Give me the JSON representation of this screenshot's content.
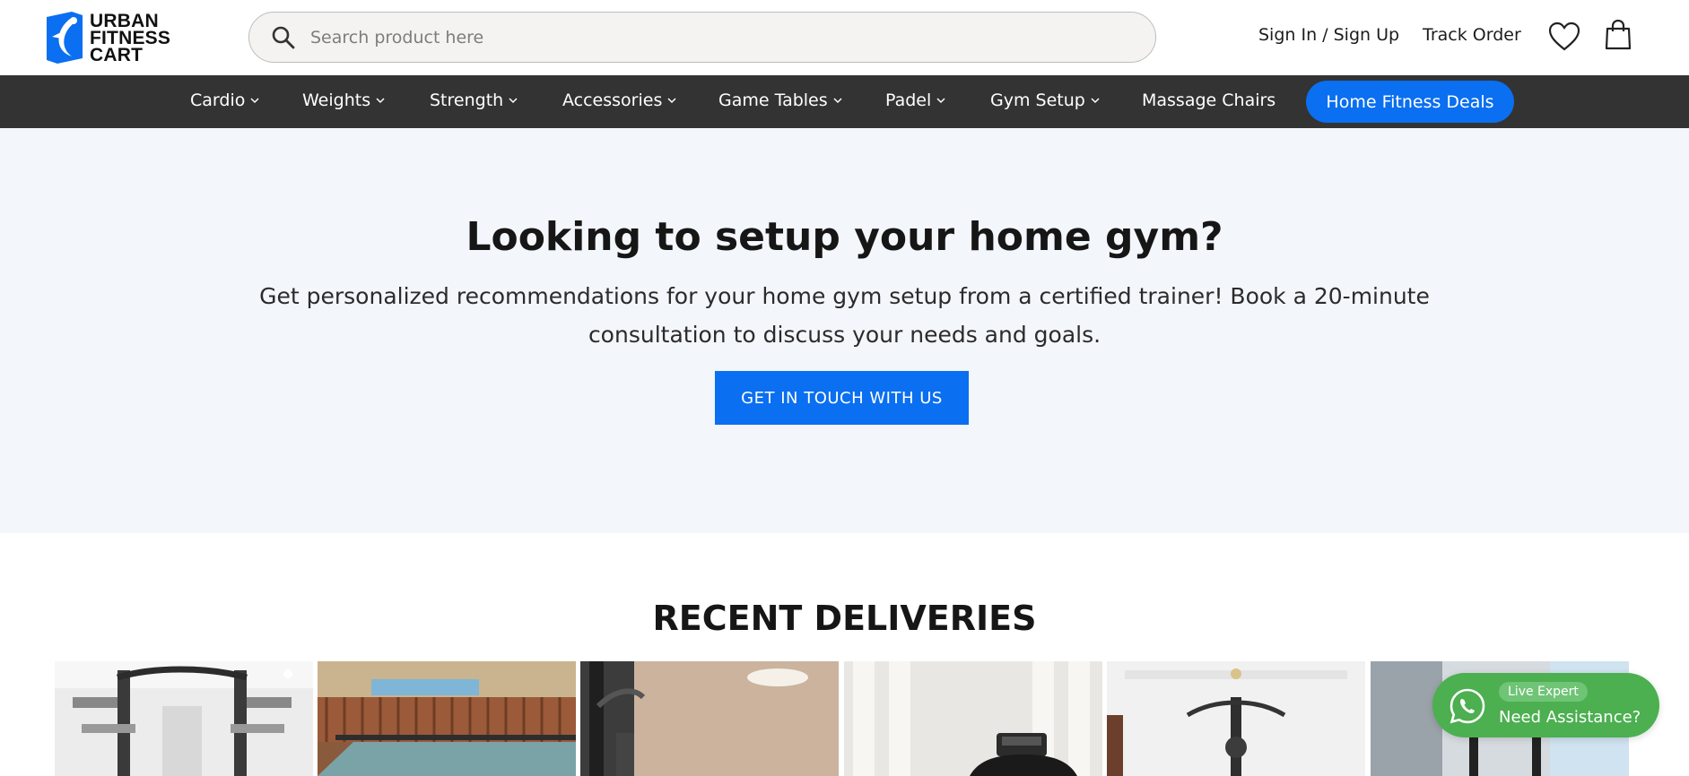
{
  "brand": {
    "name_lines": [
      "URBAN",
      "FITNESS",
      "CART"
    ],
    "accent": "#0a6ff0"
  },
  "search": {
    "placeholder": "Search product here"
  },
  "header": {
    "signin_label": "Sign In / Sign Up",
    "track_label": "Track Order"
  },
  "nav": {
    "items": [
      {
        "label": "Cardio"
      },
      {
        "label": "Weights"
      },
      {
        "label": "Strength"
      },
      {
        "label": "Accessories"
      },
      {
        "label": "Game Tables"
      },
      {
        "label": "Padel"
      },
      {
        "label": "Gym Setup"
      },
      {
        "label": "Massage Chairs"
      }
    ],
    "deals_label": "Home Fitness Deals"
  },
  "hero": {
    "title": "Looking to setup your home gym?",
    "description": "Get personalized recommendations for your home gym setup from a certified trainer! Book a 20-minute consultation to discuss your needs and goals.",
    "button_label": "GET IN TOUCH WITH US"
  },
  "deliveries": {
    "title": "RECENT DELIVERIES",
    "photos": [
      "power-rack-photo",
      "table-tennis-photo",
      "cable-machine-photo",
      "treadmill-photo",
      "home-gym-photo",
      "squat-rack-photo"
    ]
  },
  "chat_widget": {
    "badge": "Live Expert",
    "label": "Need Assistance?",
    "color": "#4caf50"
  }
}
